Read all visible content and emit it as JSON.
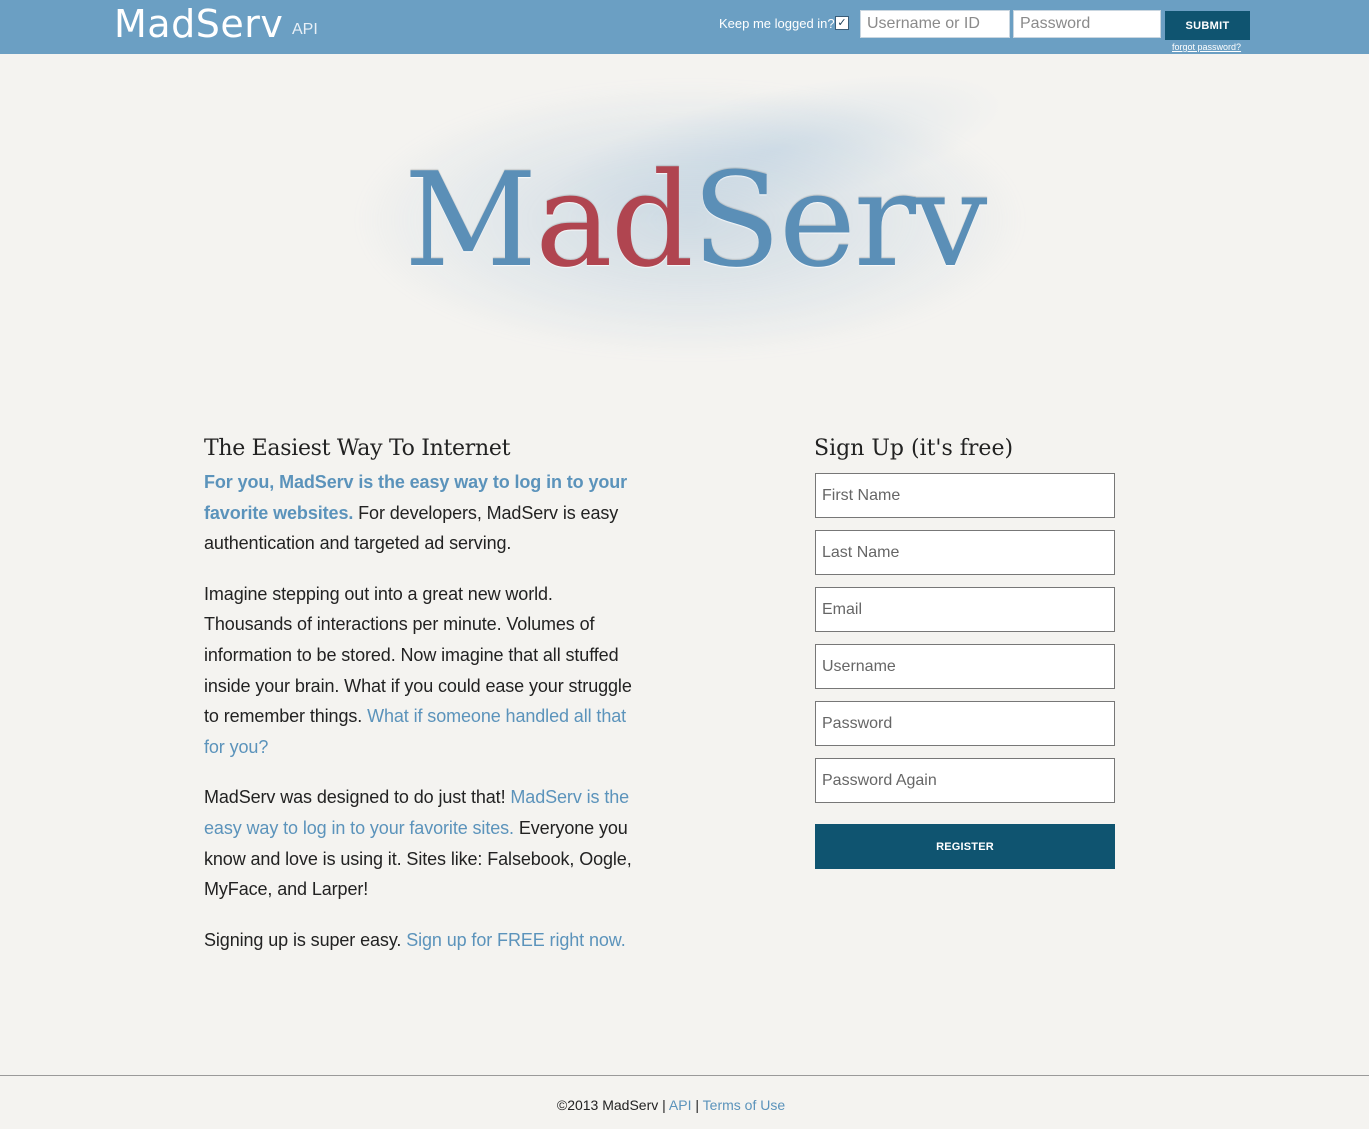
{
  "header": {
    "brand": "MadServ",
    "api_link": "API",
    "keep_logged_label": "Keep me logged in?",
    "keep_logged_checked": true,
    "username_placeholder": "Username or ID",
    "password_placeholder": "Password",
    "submit_label": "SUBMIT",
    "forgot_label": "forgot password?"
  },
  "hero": {
    "title_part1": "M",
    "title_part2": "ad",
    "title_part3": "Serv"
  },
  "intro": {
    "title": "The Easiest Way To Internet",
    "p1_highlight": "For you, MadServ is the easy way to log in to your favorite websites.",
    "p1_rest": " For developers, MadServ is easy authentication and targeted ad serving.",
    "p2_text": "Imagine stepping out into a great new world. Thousands of interactions per minute. Volumes of information to be stored. Now imagine that all stuffed inside your brain. What if you could ease your struggle to remember things. ",
    "p2_link": "What if someone handled all that for you?",
    "p3_text1": "MadServ was designed to do just that! ",
    "p3_link": "MadServ is the easy way to log in to your favorite sites.",
    "p3_text2": " Everyone you know and love is using it. Sites like: Falsebook, Oogle, MyFace, and Larper!",
    "p4_text": "Signing up is super easy. ",
    "p4_link": "Sign up for FREE right now."
  },
  "signup": {
    "title": "Sign Up (it's free)",
    "first_name": "First Name",
    "last_name": "Last Name",
    "email": "Email",
    "username": "Username",
    "password": "Password",
    "password_again": "Password Again",
    "register_label": "REGISTER"
  },
  "footer": {
    "copyright": "©2013 MadServ",
    "sep1": " | ",
    "api": "API",
    "sep2": " | ",
    "terms": "Terms of Use"
  },
  "colors": {
    "topbar": "#6b9fc3",
    "button": "#0f5470",
    "link": "#5b93bb",
    "hero_red": "#b04550"
  }
}
